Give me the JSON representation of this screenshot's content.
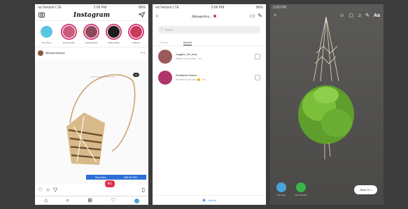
{
  "feed": {
    "status": {
      "carrier": "•ul Verizon LTE",
      "time": "2:06 PM",
      "battery": "86%"
    },
    "app_title": "Instagram",
    "stories": [
      {
        "name": "Your Story",
        "color": "#5bc6e0",
        "own": true
      },
      {
        "name": "jennaroselife",
        "color": "#c95a7a",
        "own": false
      },
      {
        "name": "thedesignhub",
        "color": "#8a4a5a",
        "own": false
      },
      {
        "name": "kathrynstyle",
        "color": "#1e1e1e",
        "own": false
      },
      {
        "name": "mattrose",
        "color": "#c8395c",
        "own": false
      }
    ],
    "post": {
      "username": "littlepaperboutique",
      "caption_tag": "• • • • • • • • • • • • • •",
      "pill": "12",
      "shop_labels": [
        "Shop Now",
        "$48.00 USD"
      ],
      "notif_count": "1"
    },
    "icons": {
      "camera": "camera-icon",
      "send": "send-icon",
      "heart": "heart-icon",
      "comment": "comment-icon",
      "share": "share-icon",
      "bookmark": "bookmark-icon",
      "home": "home-icon",
      "search": "search-icon",
      "add": "add-icon",
      "activity": "heart-icon"
    }
  },
  "direct": {
    "status": {
      "carrier": "•ul Verizon LTE",
      "time": "2:06 PM",
      "battery": "86%"
    },
    "title": "littlepaperbou...",
    "search_placeholder": "Search",
    "tabs": [
      "Primary",
      "General"
    ],
    "active_tab": 1,
    "threads": [
      {
        "name": "maggiee_the_boss",
        "msg": "Replied to your story",
        "time": "1m",
        "color": "#9a5a5a"
      },
      {
        "name": "thelittlepink.flowers",
        "msg": "Reacted to your story",
        "time": "2m",
        "color": "#b0356a"
      }
    ],
    "footer_label": "Camera"
  },
  "story": {
    "status": {
      "time": "2:06 PM"
    },
    "tools": [
      "smiley-face-icon",
      "sticker-icon",
      "music-icon",
      "draw-icon"
    ],
    "text_tool": "Aa",
    "close": "×",
    "bottom": [
      {
        "label": "Your Story",
        "color": "#4aa3d9"
      },
      {
        "label": "Close Friends",
        "color": "#39b54a"
      }
    ],
    "send_to": "Send To ›"
  }
}
